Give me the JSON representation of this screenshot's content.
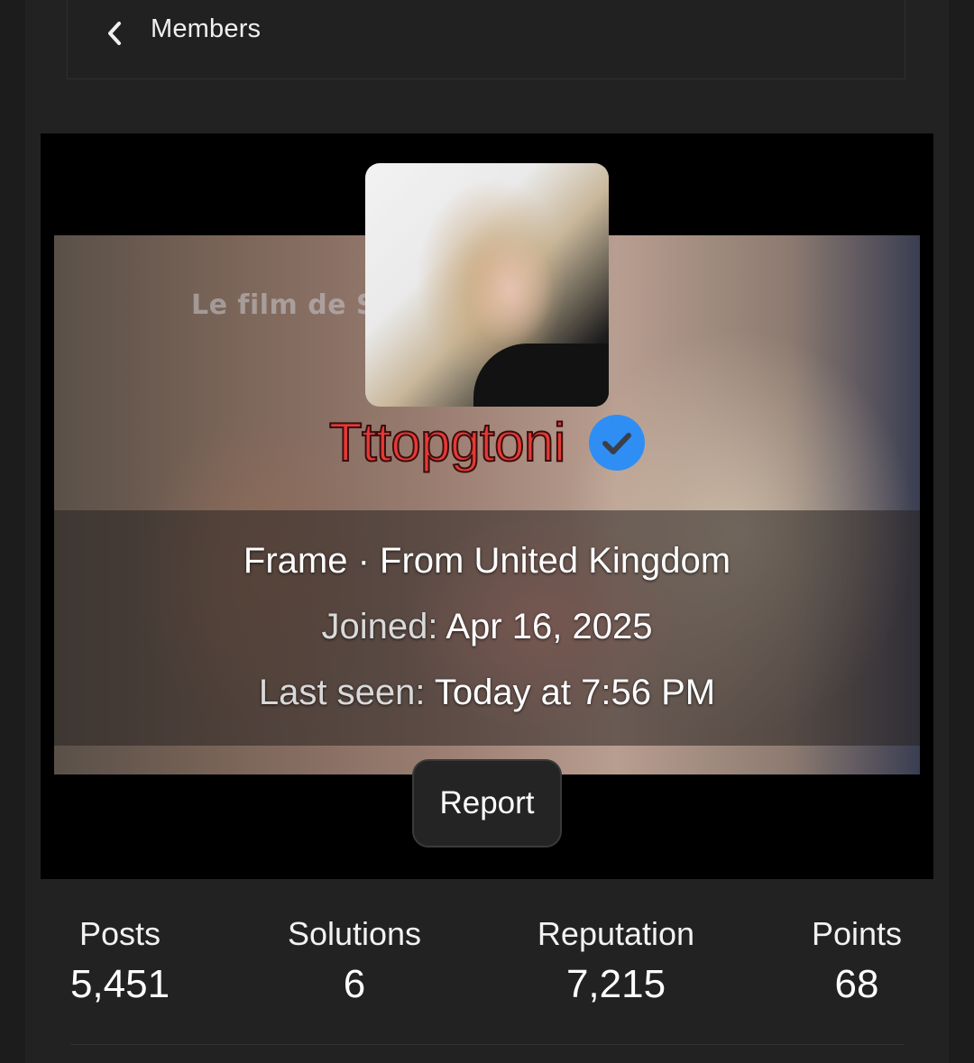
{
  "nav": {
    "back_icon": "chevron-left-icon",
    "label": "Members"
  },
  "profile": {
    "banner_text": "Le film de Sa",
    "username": "Tttopgtoni",
    "username_color": "#e53935",
    "verified_icon": "verified-check-icon",
    "verified_color": "#2f8ef4",
    "title_location": "Frame · From United Kingdom",
    "joined_label": "Joined:",
    "joined_value": "Apr 16, 2025",
    "last_seen_label": "Last seen:",
    "last_seen_value": "Today at 7:56 PM",
    "report_label": "Report"
  },
  "stats": [
    {
      "label": "Posts",
      "value": "5,451"
    },
    {
      "label": "Solutions",
      "value": "6"
    },
    {
      "label": "Reputation",
      "value": "7,215"
    },
    {
      "label": "Points",
      "value": "68"
    }
  ]
}
